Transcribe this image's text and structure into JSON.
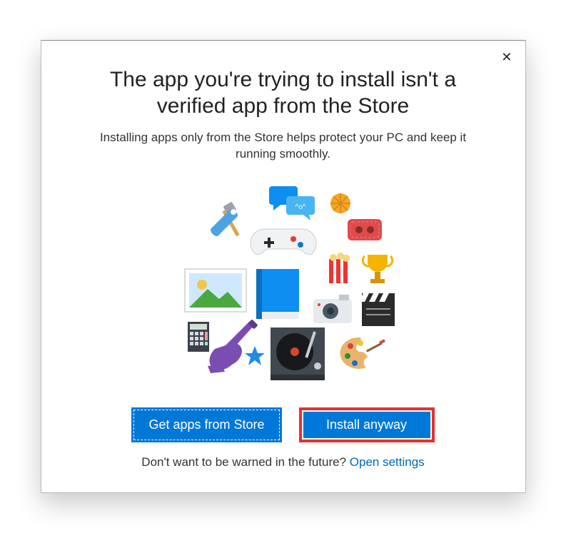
{
  "dialog": {
    "title": "The app you're trying to install isn't a verified app from the Store",
    "subtitle": "Installing apps only from the Store helps protect your PC and keep it running smoothly.",
    "buttons": {
      "store": "Get apps from Store",
      "install": "Install anyway"
    },
    "footer": {
      "text": "Don't want to be warned in the future?  ",
      "link": "Open settings"
    }
  }
}
